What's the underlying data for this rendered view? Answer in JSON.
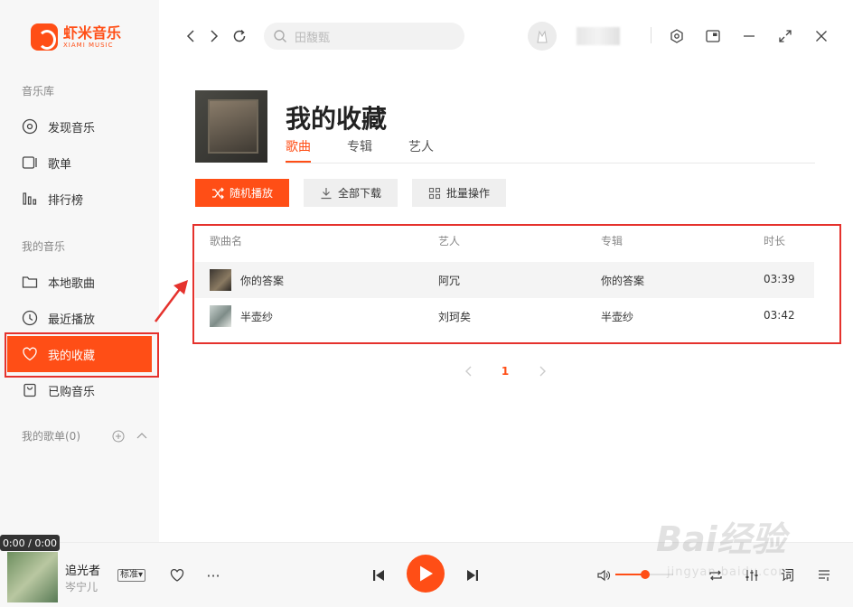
{
  "app": {
    "name": "虾米音乐",
    "sub": "XIAMI MUSIC"
  },
  "sidebar": {
    "library_title": "音乐库",
    "library_items": [
      {
        "label": "发现音乐"
      },
      {
        "label": "歌单"
      },
      {
        "label": "排行榜"
      }
    ],
    "mine_title": "我的音乐",
    "mine_items": [
      {
        "label": "本地歌曲"
      },
      {
        "label": "最近播放"
      },
      {
        "label": "我的收藏"
      },
      {
        "label": "已购音乐"
      }
    ],
    "playlists_label": "我的歌单(0)"
  },
  "search": {
    "placeholder": "田馥甄"
  },
  "page": {
    "title": "我的收藏",
    "tabs": [
      {
        "label": "歌曲",
        "active": true
      },
      {
        "label": "专辑"
      },
      {
        "label": "艺人"
      }
    ]
  },
  "actions": {
    "shuffle": "随机播放",
    "download_all": "全部下载",
    "batch": "批量操作"
  },
  "table": {
    "columns": [
      "歌曲名",
      "艺人",
      "专辑",
      "时长"
    ],
    "rows": [
      {
        "title": "你的答案",
        "artist": "阿冗",
        "album": "你的答案",
        "duration": "03:39"
      },
      {
        "title": "半壶纱",
        "artist": "刘珂矣",
        "album": "半壶纱",
        "duration": "03:42"
      }
    ]
  },
  "pagination": {
    "current": "1"
  },
  "player": {
    "time": "0:00 / 0:00",
    "song": "追光者",
    "artist": "岑宁儿",
    "quality": "标准",
    "volume_percent": 52,
    "lyric_label": "词"
  },
  "watermark": {
    "brand": "Bai经验",
    "url": "jingyan.baidu.com"
  },
  "colors": {
    "accent": "#ff4e16",
    "annotation": "#e5322d"
  }
}
